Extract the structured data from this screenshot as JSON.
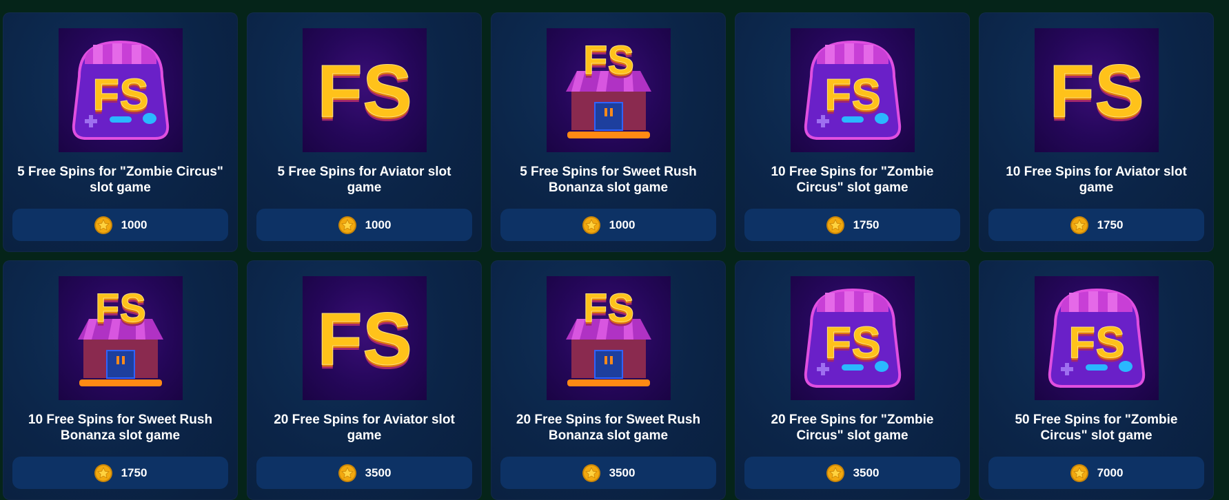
{
  "items": [
    {
      "title": "5 Free Spins for \"Zombie Circus\" slot game",
      "price": "1000",
      "icon": "fs-console-icon",
      "kind": "console"
    },
    {
      "title": "5 Free Spins for Aviator slot game",
      "price": "1000",
      "icon": "fs-letters-icon",
      "kind": "letters"
    },
    {
      "title": "5 Free Spins for Sweet Rush Bonanza slot game",
      "price": "1000",
      "icon": "fs-shop-icon",
      "kind": "shop"
    },
    {
      "title": "10 Free Spins for \"Zombie Circus\" slot game",
      "price": "1750",
      "icon": "fs-console-icon",
      "kind": "console"
    },
    {
      "title": "10 Free Spins for Aviator slot game",
      "price": "1750",
      "icon": "fs-letters-icon",
      "kind": "letters"
    },
    {
      "title": "10 Free Spins for Sweet Rush Bonanza slot game",
      "price": "1750",
      "icon": "fs-shop-icon",
      "kind": "shop"
    },
    {
      "title": "20 Free Spins for Aviator slot game",
      "price": "3500",
      "icon": "fs-letters-icon",
      "kind": "letters"
    },
    {
      "title": "20 Free Spins for Sweet Rush Bonanza slot game",
      "price": "3500",
      "icon": "fs-shop-icon",
      "kind": "shop"
    },
    {
      "title": "20 Free Spins for \"Zombie Circus\" slot game",
      "price": "3500",
      "icon": "fs-console-icon",
      "kind": "console"
    },
    {
      "title": "50 Free Spins for \"Zombie Circus\" slot game",
      "price": "7000",
      "icon": "fs-console-icon",
      "kind": "console"
    }
  ],
  "colors": {
    "background": "#052419",
    "card": "#0b2447",
    "price_bar": "#0d3265",
    "coin": "#f2a90f",
    "fs_text": "#ffc21a"
  },
  "coin_icon": "star-coin-icon"
}
